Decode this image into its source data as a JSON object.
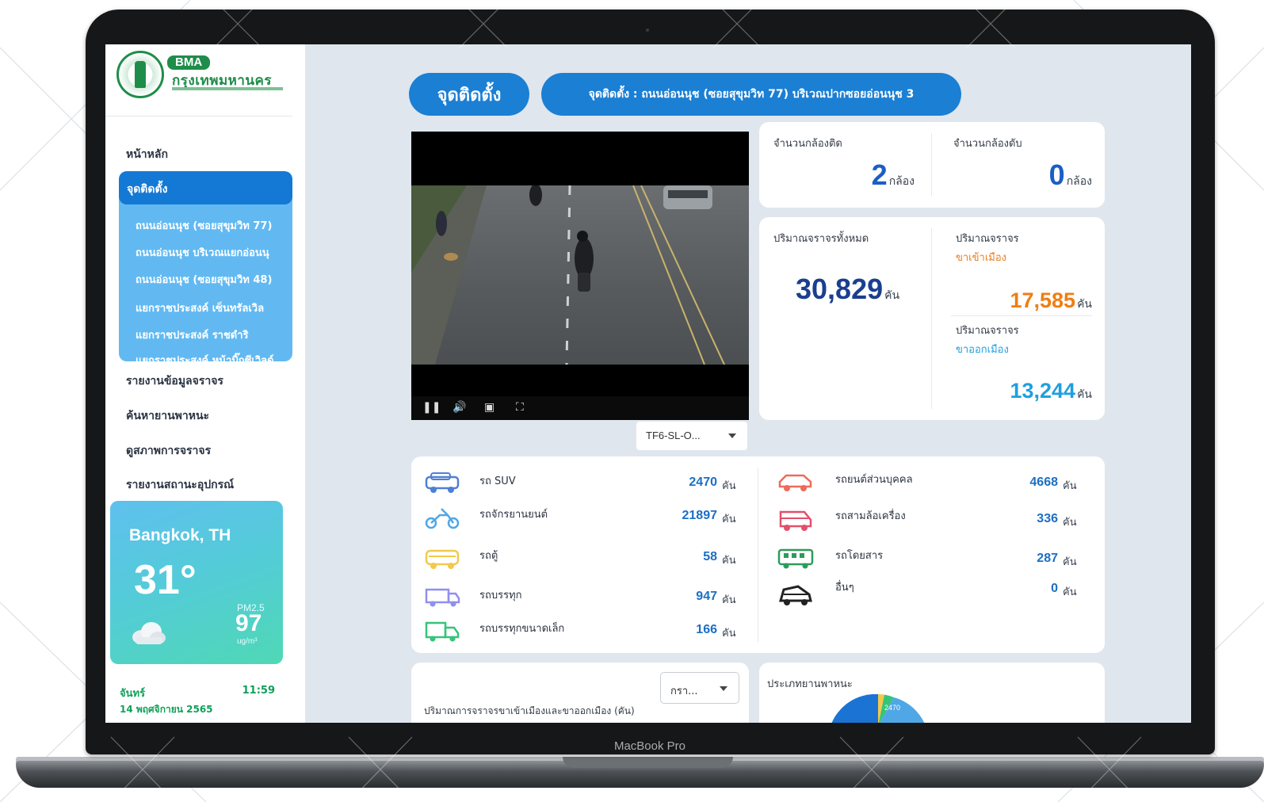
{
  "bezel_label": "MacBook Pro",
  "logo": {
    "badge": "BMA",
    "name": "กรุงเทพมหานคร",
    "seal_icon": "bma-seal-icon"
  },
  "sidebar": {
    "home": "หน้าหลัก",
    "active_section": "จุดติดตั้ง",
    "sub_items": [
      "ถนนอ่อนนุช (ซอยสุขุมวิท 77)",
      "ถนนอ่อนนุช บริเวณแยกอ่อนนุ",
      "ถนนอ่อนนุช (ซอยสุขุมวิท 48)",
      "แยกราชประสงค์ เซ็นทรัลเวิล",
      "แยกราชประสงค์ ราชดำริ",
      "แยกราชประสงค์ หน้าบิ๊กซีเวิลด์"
    ],
    "items": [
      "รายงานข้อมูลจราจร",
      "ค้นหายานพาหนะ",
      "ดูสภาพการจราจร",
      "รายงานสถานะอุปกรณ์"
    ]
  },
  "weather": {
    "city": "Bangkok, TH",
    "temp": "31°",
    "pm_label": "PM2.5",
    "pm_value": "97",
    "pm_unit": "ug/m³",
    "icon": "cloud-icon"
  },
  "date": {
    "day": "จันทร์",
    "time": "11:59",
    "full": "14 พฤศจิกายน 2565"
  },
  "header": {
    "button": "จุดติดตั้ง",
    "location": "จุดติดตั้ง : ถนนอ่อนนุช (ซอยสุขุมวิท 77) บริเวณปากซอยอ่อนนุช 3"
  },
  "video": {
    "camera_select": "TF6-SL-O..."
  },
  "cameras": {
    "on_label": "จำนวนกล้องติด",
    "on_value": "2",
    "on_unit": "กล้อง",
    "off_label": "จำนวนกล้องดับ",
    "off_value": "0",
    "off_unit": "กล้อง"
  },
  "traffic": {
    "total_label": "ปริมาณจราจรทั้งหมด",
    "total_value": "30,829",
    "unit": "คัน",
    "in_label": "ปริมาณจราจร",
    "in_sub": "ขาเข้าเมือง",
    "in_value": "17,585",
    "out_label": "ปริมาณจราจร",
    "out_sub": "ขาออกเมือง",
    "out_value": "13,244"
  },
  "vehicles_left": [
    {
      "name": "รถ SUV",
      "value": "2470",
      "unit": "คัน",
      "icon": "suv-icon",
      "color": "#4f7fd6"
    },
    {
      "name": "รถจักรยานยนต์",
      "value": "21897",
      "unit": "คัน",
      "icon": "motorcycle-icon",
      "color": "#4fa7e6"
    },
    {
      "name": "รถตู้",
      "value": "58",
      "unit": "คัน",
      "icon": "van-icon",
      "color": "#f2c94c"
    },
    {
      "name": "รถบรรทุก",
      "value": "947",
      "unit": "คัน",
      "icon": "truck-icon",
      "color": "#8f8ff0"
    },
    {
      "name": "รถบรรทุกขนาดเล็ก",
      "value": "166",
      "unit": "คัน",
      "icon": "small-truck-icon",
      "color": "#35c47a"
    }
  ],
  "vehicles_right": [
    {
      "name": "รถยนต์ส่วนบุคคล",
      "value": "4668",
      "unit": "คัน",
      "icon": "car-icon",
      "color": "#ee6b5a"
    },
    {
      "name": "รถสามล้อเครื่อง",
      "value": "336",
      "unit": "คัน",
      "icon": "tuktuk-icon",
      "color": "#e2506a"
    },
    {
      "name": "รถโดยสาร",
      "value": "287",
      "unit": "คัน",
      "icon": "bus-icon",
      "color": "#2f9b5a"
    },
    {
      "name": "อื่นๆ",
      "value": "0",
      "unit": "คัน",
      "icon": "other-vehicle-icon",
      "color": "#222222"
    }
  ],
  "bottom": {
    "month_select": "กรา...",
    "chart_title_left": "ปริมาณการจราจรขาเข้าเมืองและขาออกเมือง (คัน)",
    "chart_title_right": "ประเภทยานพาหนะ",
    "pie_label": "2470"
  }
}
